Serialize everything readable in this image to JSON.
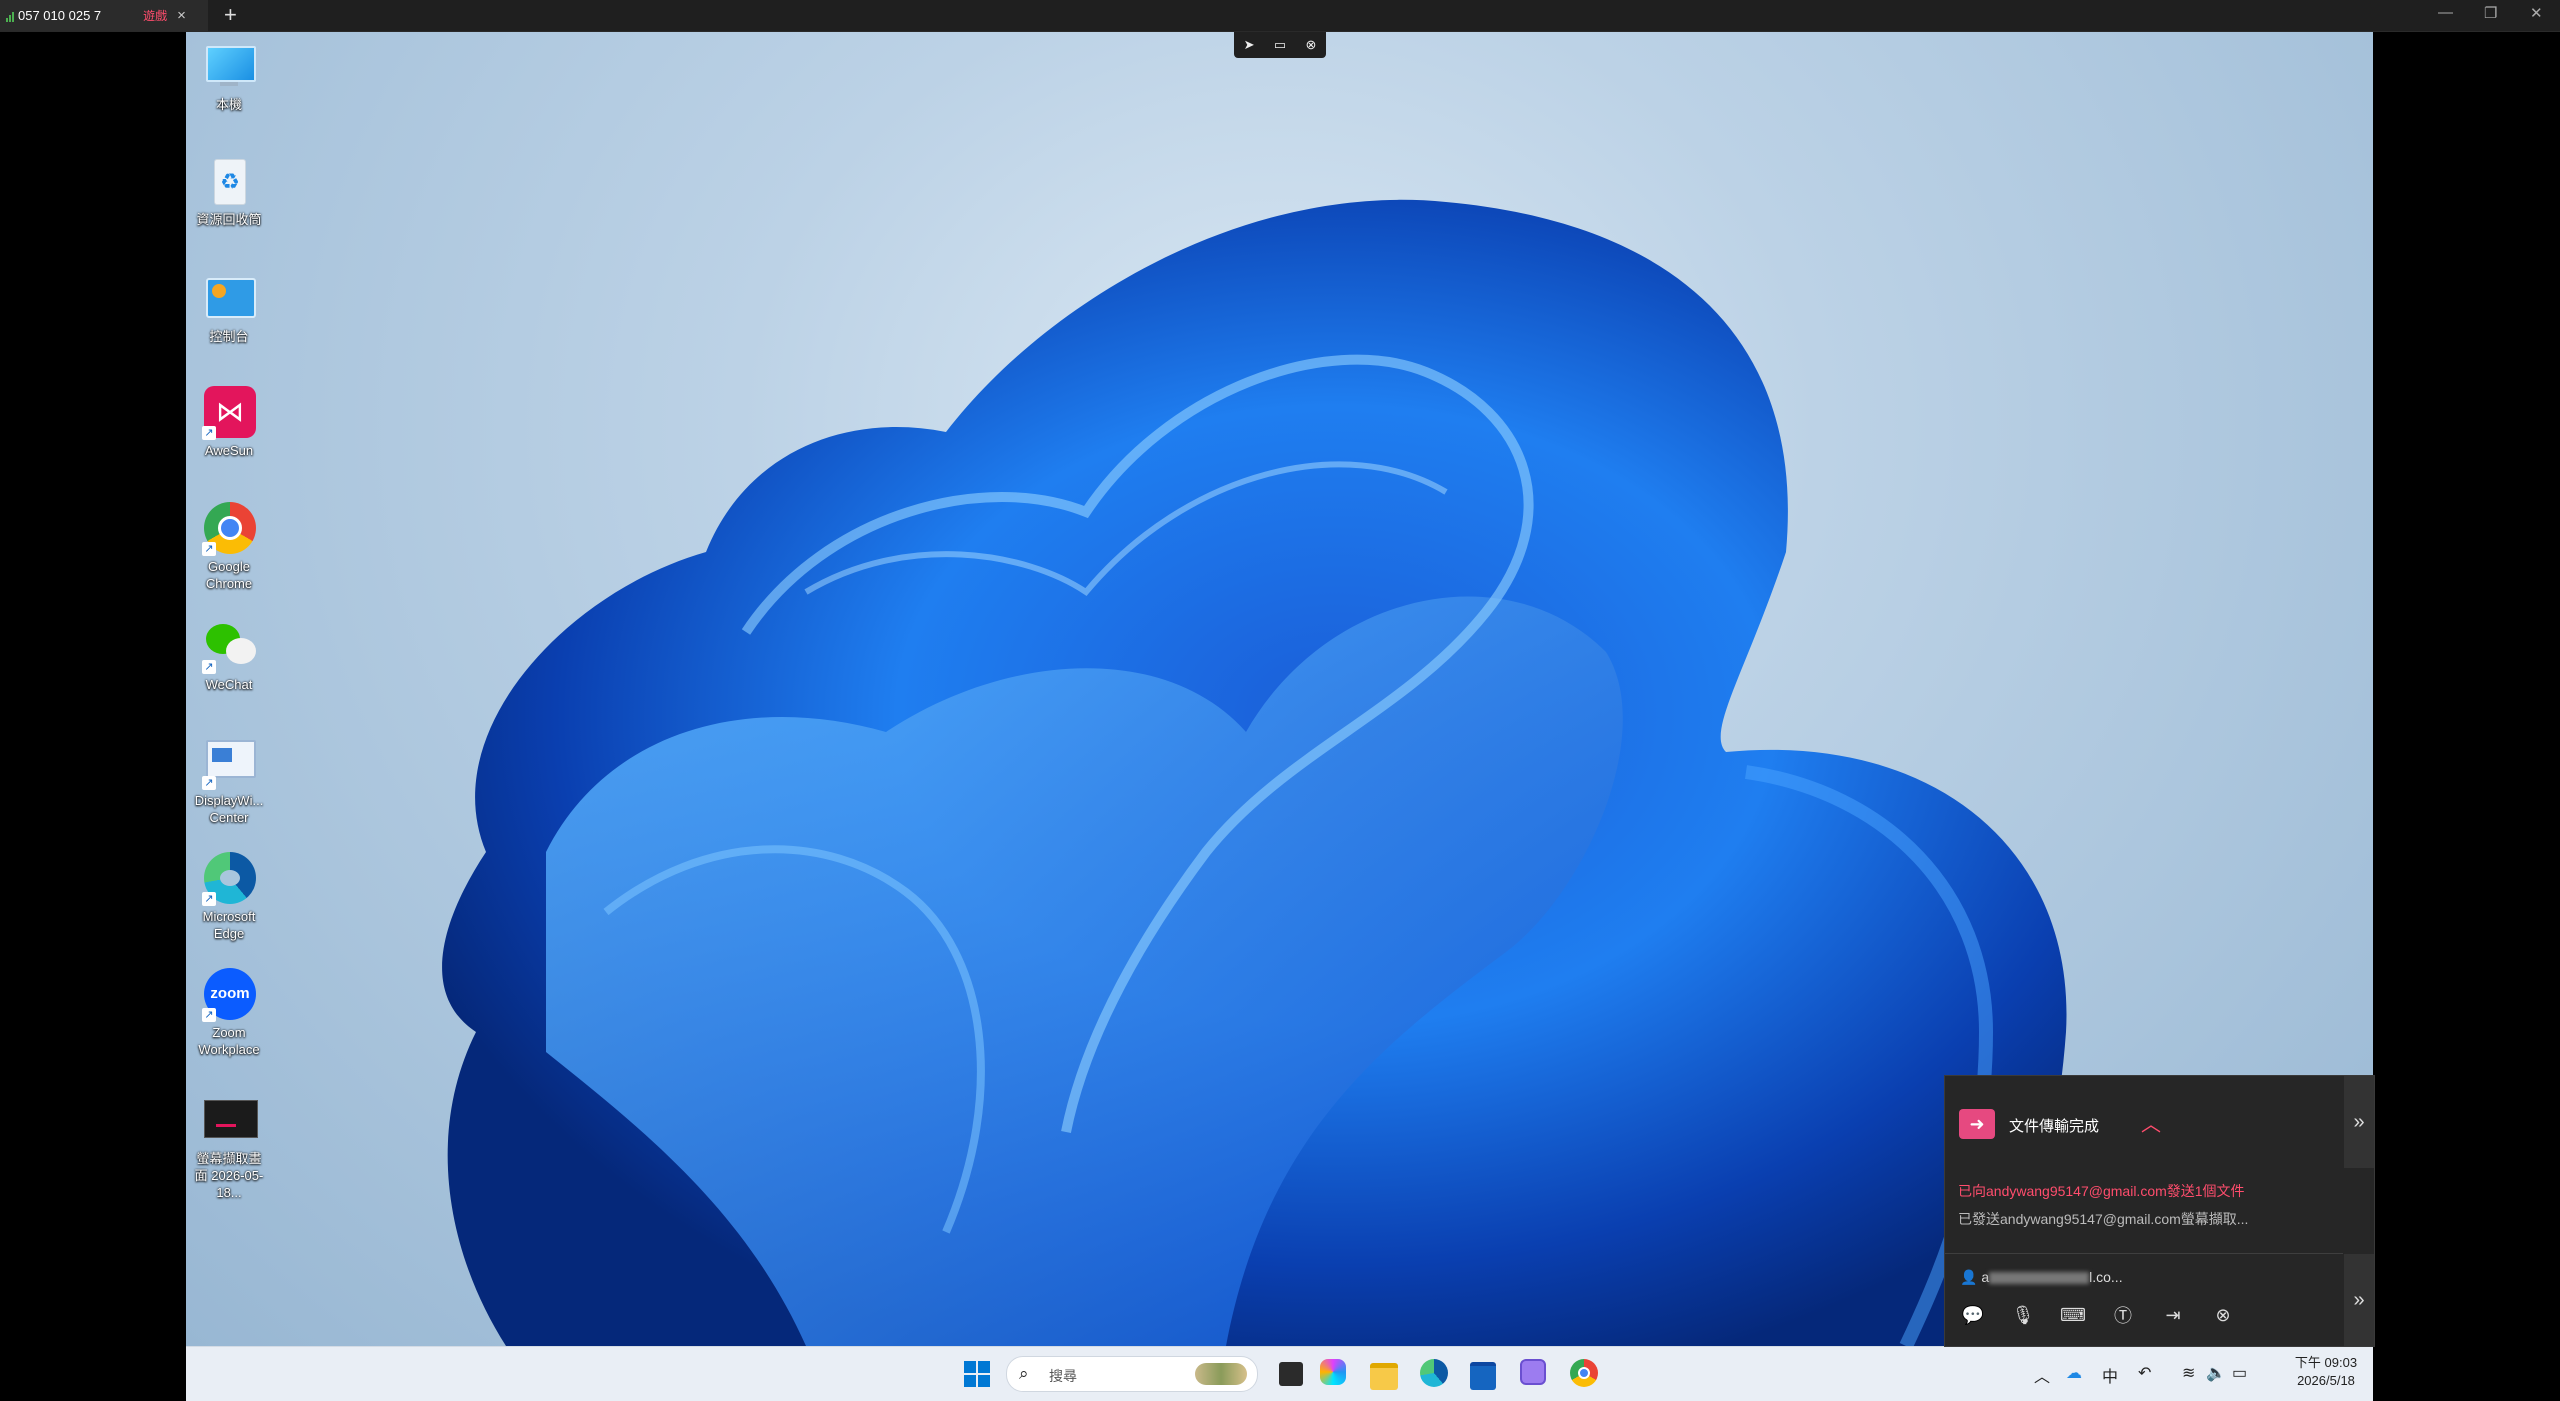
{
  "client": {
    "session_id": "057 010 025 7",
    "badge": "遊戲",
    "close_tab_glyph": "×",
    "new_tab_glyph": "+",
    "window_controls": [
      "—",
      "❐",
      "✕"
    ]
  },
  "remote_toolbar": {
    "items": [
      "pointer-icon",
      "screen-icon",
      "close-icon"
    ]
  },
  "desktop_icons": [
    {
      "label": "本機",
      "icon": "monitor-icon"
    },
    {
      "label": "資源回收筒",
      "icon": "recycle-bin-icon"
    },
    {
      "label": "控制台",
      "icon": "control-panel-icon"
    },
    {
      "label": "AweSun",
      "icon": "awesun-icon"
    },
    {
      "label": "Google Chrome",
      "icon": "chrome-icon"
    },
    {
      "label": "WeChat",
      "icon": "wechat-icon"
    },
    {
      "label": "DisplayWi... Center",
      "icon": "display-center-icon"
    },
    {
      "label": "Microsoft Edge",
      "icon": "edge-icon"
    },
    {
      "label": "Zoom Workplace",
      "icon": "zoom-icon"
    },
    {
      "label": "螢幕擷取畫面 2026-05-18...",
      "icon": "screenshot-file-icon"
    }
  ],
  "transfer_panel": {
    "title": "文件傳輸完成",
    "log": [
      "已向andywang95147@gmail.com發送1個文件",
      "已發送andywang95147@gmail.com螢幕擷取..."
    ],
    "user_prefix": "a",
    "user_suffix": "l.co...",
    "tools": [
      "chat-icon",
      "microphone-icon",
      "remote-control-icon",
      "text-icon",
      "file-transfer-icon",
      "close-circle-icon"
    ]
  },
  "taskbar": {
    "search_placeholder": "搜尋",
    "ime": "中",
    "clock_time": "下午 09:03",
    "clock_date": "2026/5/18"
  },
  "colors": {
    "accent": "#ff4d6d",
    "taskbar_bg": "#e9eef5",
    "panel_bg": "#262626"
  }
}
